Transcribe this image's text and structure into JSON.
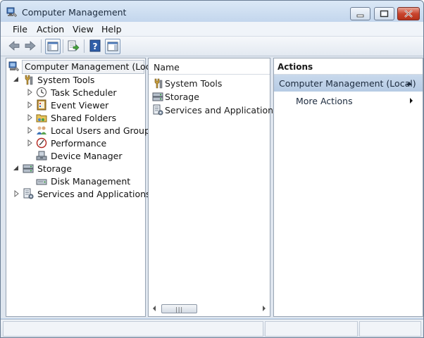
{
  "window": {
    "title": "Computer Management",
    "icon": "computer-management-icon",
    "controls": [
      "minimize",
      "maximize",
      "close"
    ]
  },
  "menu": {
    "items": [
      "File",
      "Action",
      "View",
      "Help"
    ]
  },
  "toolbar": {
    "buttons": [
      "back-arrow-icon",
      "forward-arrow-icon",
      "show-hide-console-tree-icon",
      "export-list-icon",
      "help-icon",
      "show-hide-action-pane-icon"
    ]
  },
  "tree": {
    "root": "Computer Management (Local)",
    "system_tools": "System Tools",
    "task_scheduler": "Task Scheduler",
    "event_viewer": "Event Viewer",
    "shared_folders": "Shared Folders",
    "local_users": "Local Users and Groups",
    "performance": "Performance",
    "device_manager": "Device Manager",
    "storage": "Storage",
    "disk_management": "Disk Management",
    "services_apps": "Services and Applications"
  },
  "list": {
    "column_name": "Name",
    "items": [
      "System Tools",
      "Storage",
      "Services and Applications"
    ]
  },
  "actions": {
    "header": "Actions",
    "group": "Computer Management (Local)",
    "more": "More Actions"
  },
  "colors": {
    "accent": "#b6cbe4",
    "close_button": "#c9452e"
  }
}
